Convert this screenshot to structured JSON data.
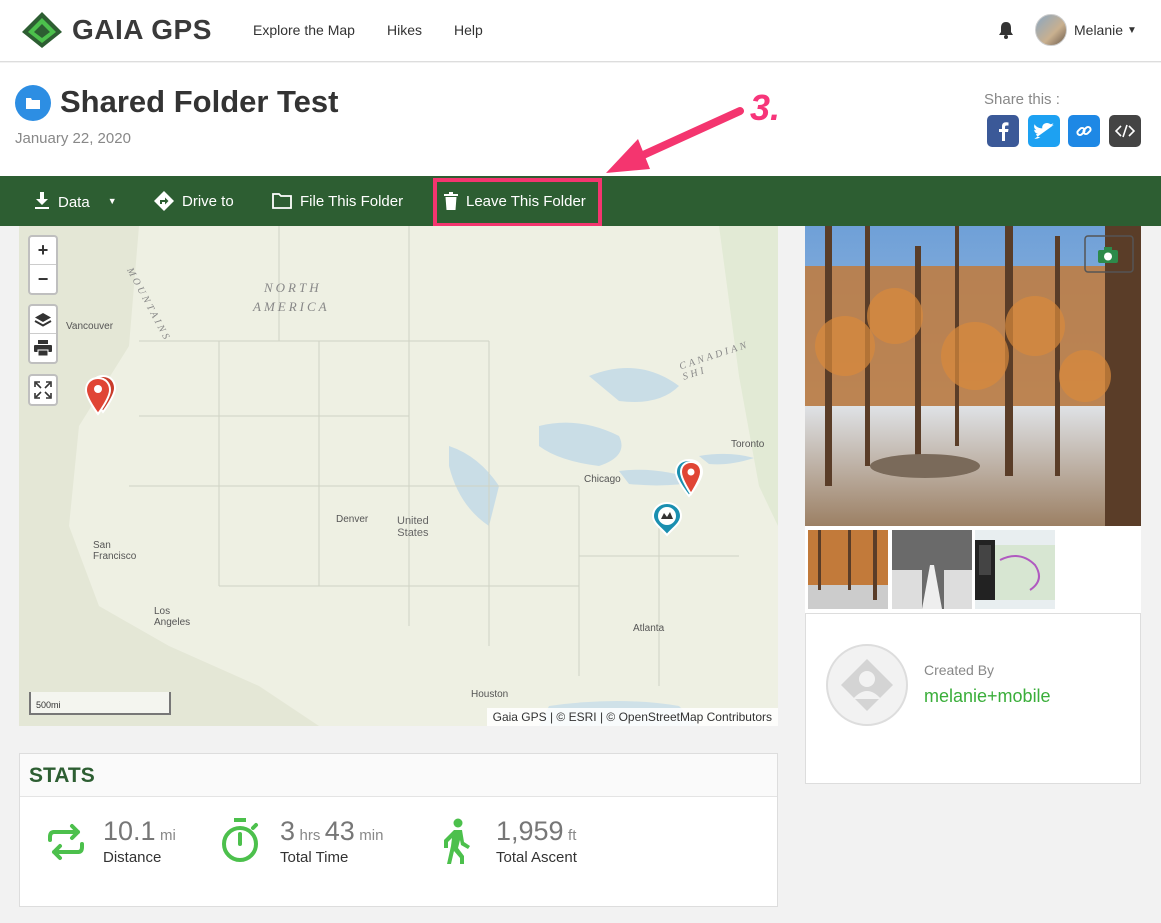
{
  "topnav": {
    "logo_text": "GAIA GPS",
    "links": [
      "Explore the Map",
      "Hikes",
      "Help"
    ],
    "user_name": "Melanie"
  },
  "header": {
    "title": "Shared Folder Test",
    "date": "January 22, 2020",
    "share_label": "Share this :",
    "annotation": "3."
  },
  "toolbar": {
    "data_label": "Data",
    "drive_label": "Drive to",
    "file_label": "File This Folder",
    "leave_label": "Leave This Folder"
  },
  "map": {
    "region_label_1": "NORTH",
    "region_label_2": "AMERICA",
    "mountains_label": "MOUNTAINS",
    "shield_label": "CANADIAN SHI",
    "country_1": "United",
    "country_2": "States",
    "cities": {
      "vancouver": "Vancouver",
      "toronto": "Toronto",
      "chicago": "Chicago",
      "denver": "Denver",
      "sanfran_1": "San",
      "sanfran_2": "Francisco",
      "la_1": "Los",
      "la_2": "Angeles",
      "atlanta": "Atlanta",
      "houston": "Houston"
    },
    "scale": "500mi",
    "attribution": "Gaia GPS | © ESRI | © OpenStreetMap Contributors"
  },
  "stats": {
    "title": "STATS",
    "distance_value": "10.1",
    "distance_unit": "mi",
    "distance_label": "Distance",
    "time_hours": "3",
    "time_hours_unit": "hrs",
    "time_minutes": "43",
    "time_minutes_unit": "min",
    "time_label": "Total Time",
    "ascent_value": "1,959",
    "ascent_unit": "ft",
    "ascent_label": "Total Ascent"
  },
  "creator": {
    "label": "Created By",
    "name": "melanie+mobile"
  },
  "colors": {
    "toolbar": "#2d5e32",
    "highlight": "#f4356f",
    "stat_icon": "#4cc04c",
    "facebook": "#3b5998",
    "twitter": "#1da1f2",
    "link": "#1e88e5",
    "embed": "#444444"
  }
}
